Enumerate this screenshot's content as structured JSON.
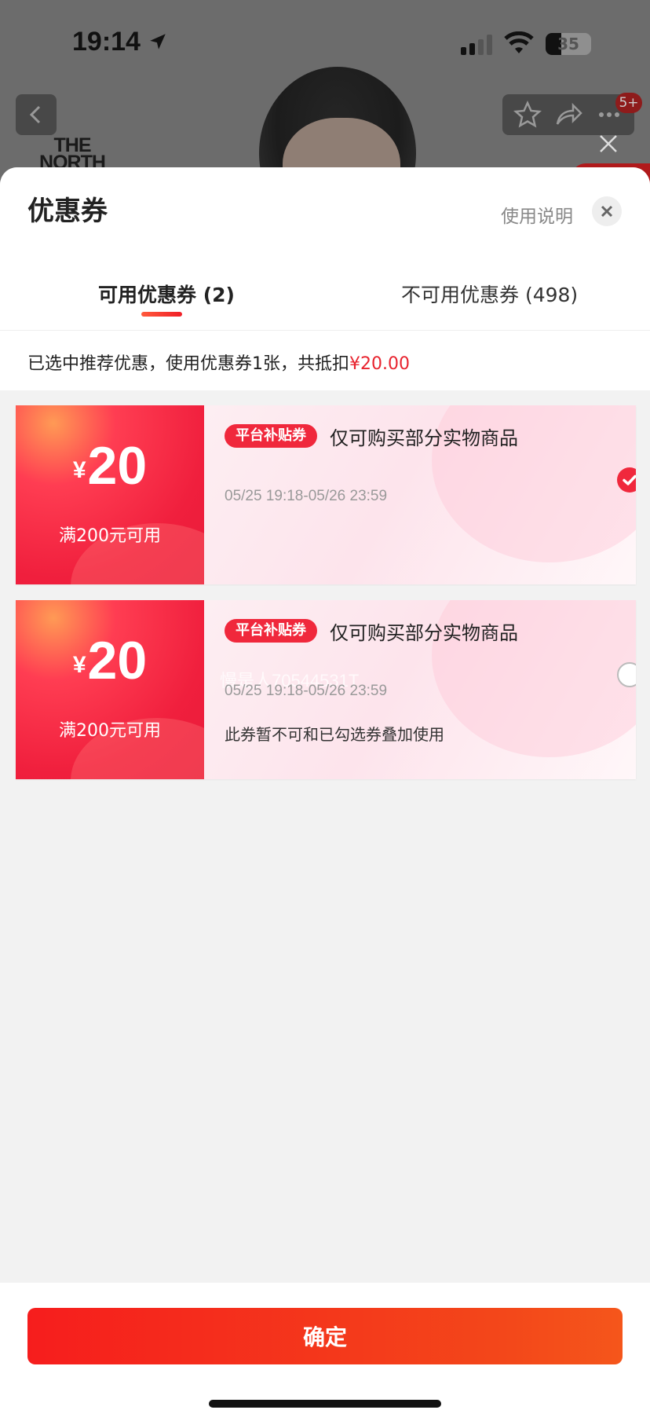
{
  "status_bar": {
    "time": "19:14",
    "battery": "35"
  },
  "background_page": {
    "brand_logo": [
      "THE",
      "NORTH"
    ],
    "nav_badge": "5+"
  },
  "sheet": {
    "title": "优惠券",
    "usage_link": "使用说明",
    "tabs": [
      {
        "label": "可用优惠券 (2)",
        "active": true
      },
      {
        "label": "不可用优惠券 (498)",
        "active": false
      }
    ],
    "summary": {
      "prefix": "已选中推荐优惠，使用优惠券1张，共抵扣",
      "amount": "¥20.00"
    },
    "coupons": [
      {
        "currency": "¥",
        "amount": "20",
        "condition": "满200元可用",
        "badge": "平台补贴券",
        "description": "仅可购买部分实物商品",
        "validity": "05/25 19:18-05/26 23:59",
        "note": "",
        "selected": true
      },
      {
        "currency": "¥",
        "amount": "20",
        "condition": "满200元可用",
        "badge": "平台补贴券",
        "description": "仅可购买部分实物商品",
        "validity": "05/25 19:18-05/26 23:59",
        "note": "此券暂不可和已勾选券叠加使用",
        "selected": false,
        "watermark": "慢是人70544531T"
      }
    ],
    "confirm_label": "确定"
  },
  "colors": {
    "accent": "#f0283c",
    "sheet_bg": "#f2f2f2"
  },
  "icons": [
    "location-arrow-icon",
    "signal-icon",
    "wifi-icon",
    "back-icon",
    "star-icon",
    "share-icon",
    "more-icon",
    "close-icon",
    "check-icon"
  ]
}
